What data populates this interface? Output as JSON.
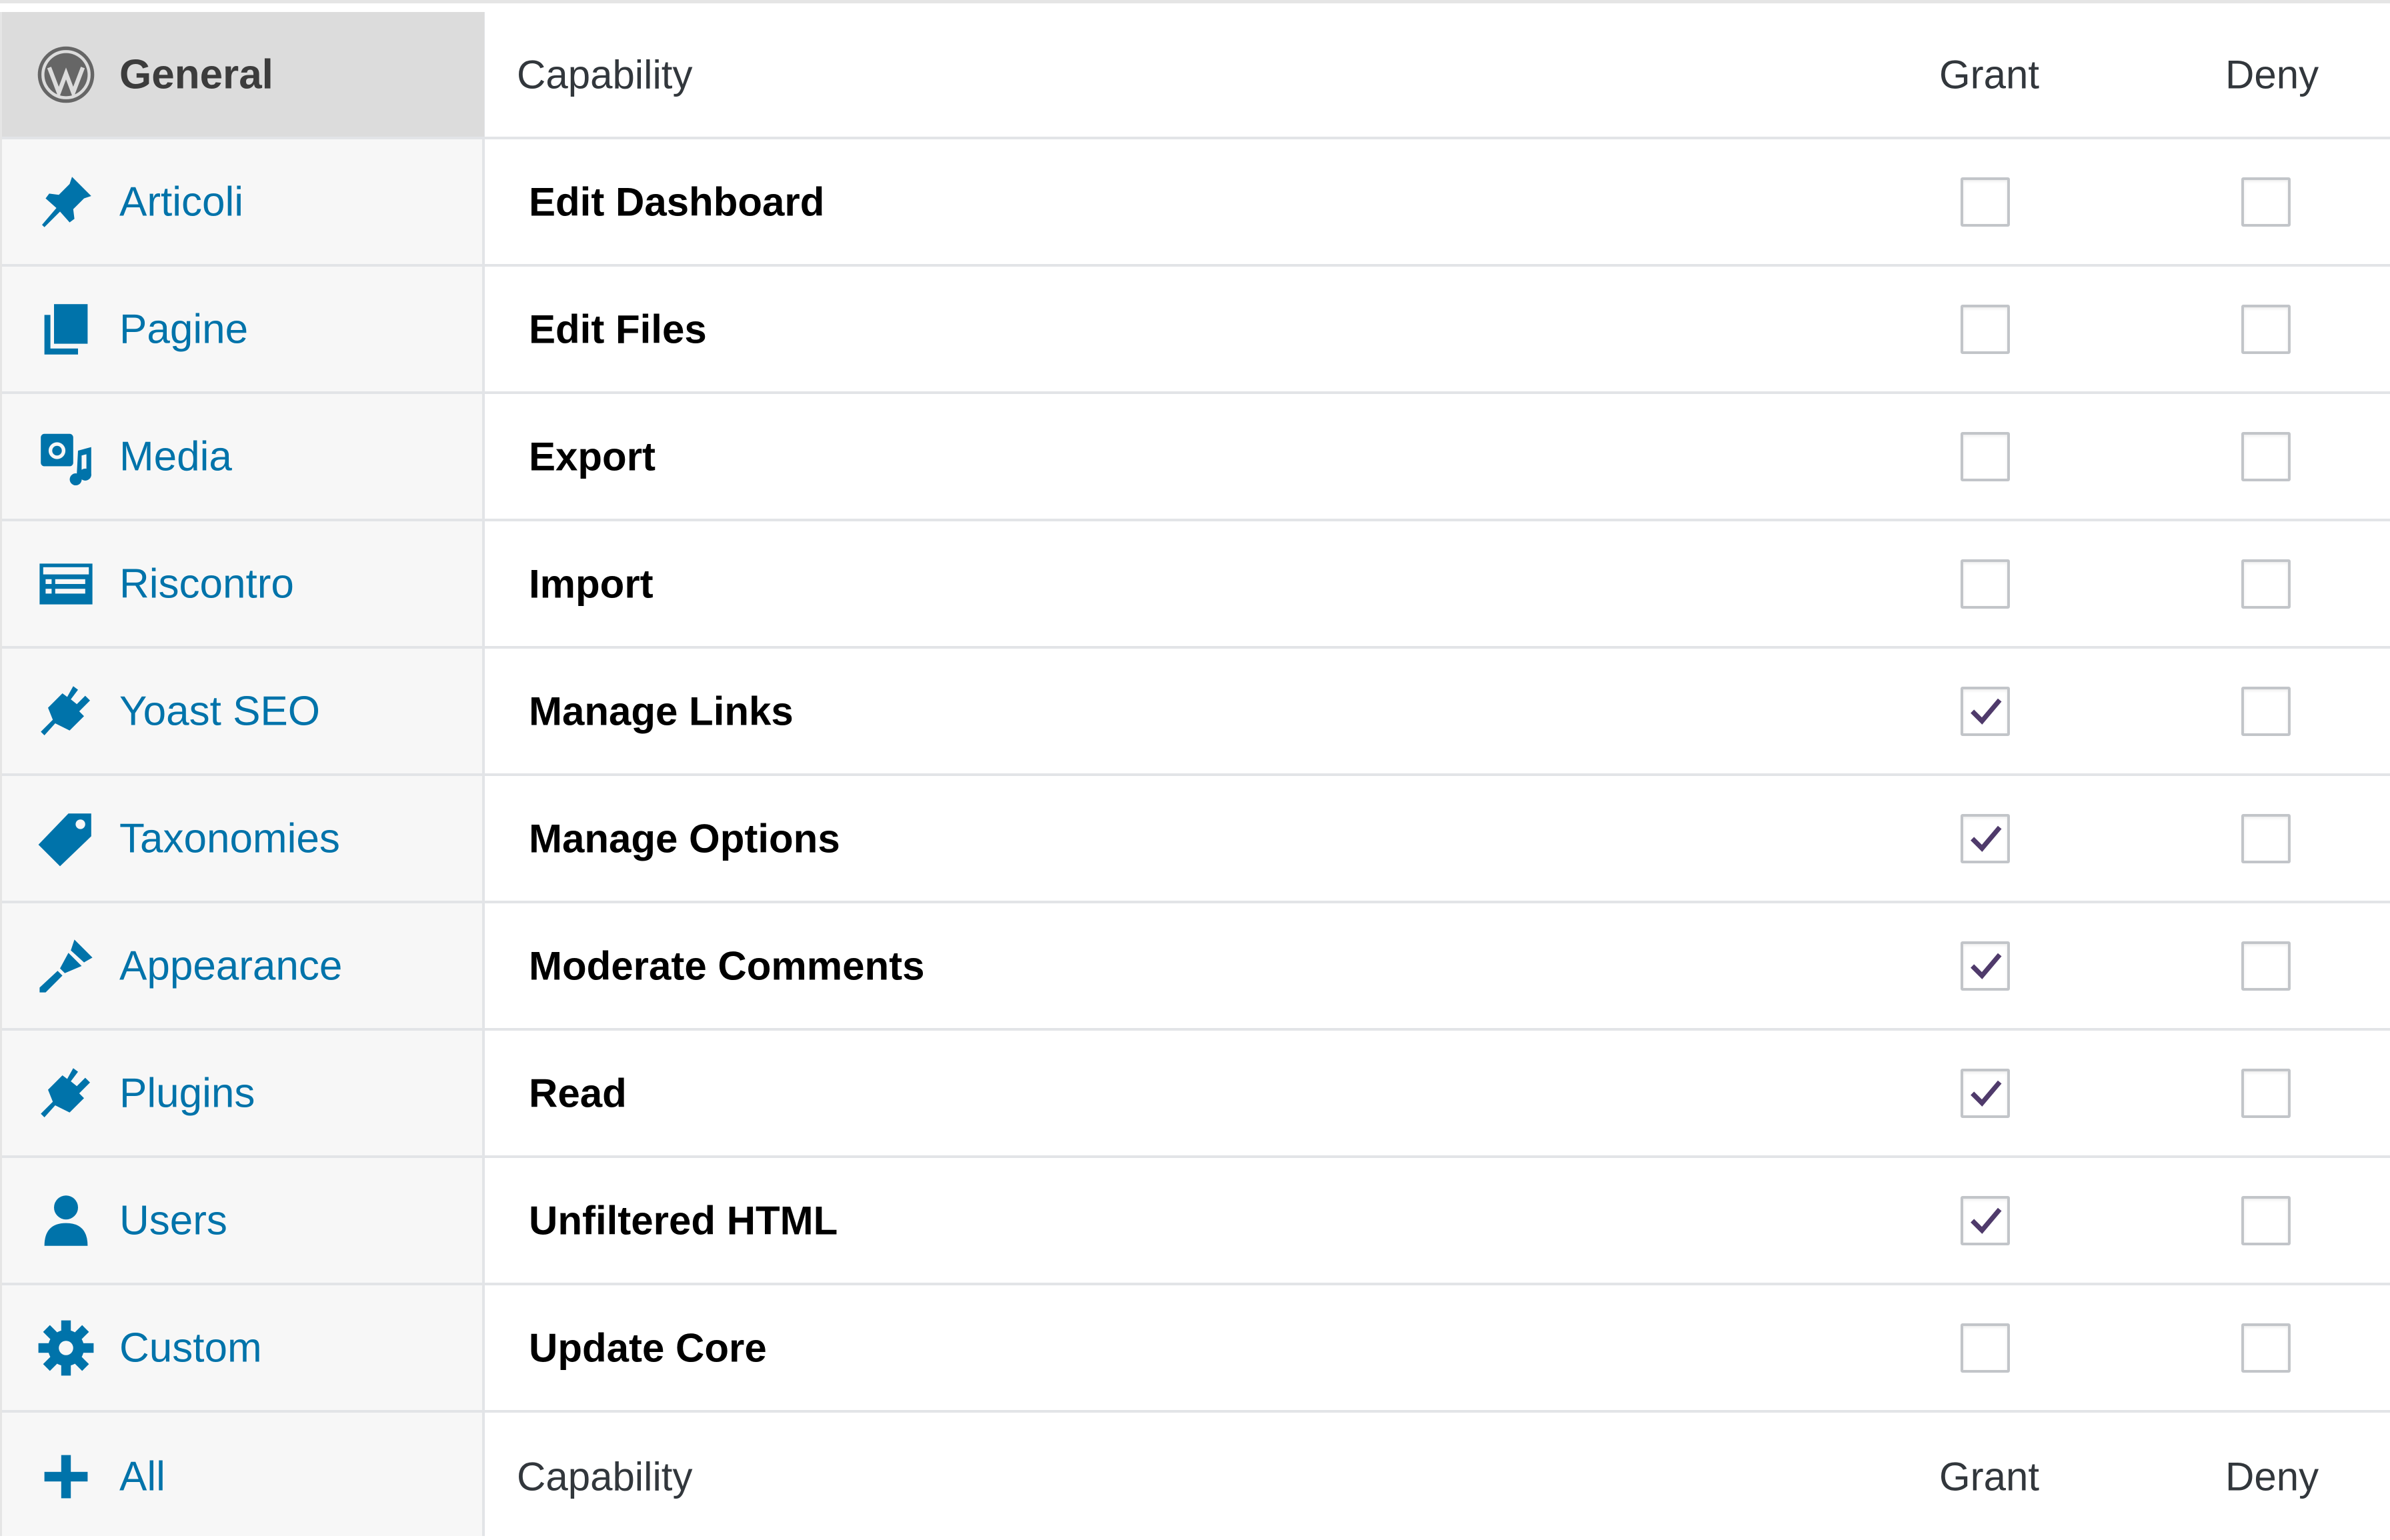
{
  "sidebar": {
    "items": [
      {
        "label": "General",
        "icon": "wordpress-logo-icon",
        "active": true
      },
      {
        "label": "Articoli",
        "icon": "pushpin-icon"
      },
      {
        "label": "Pagine",
        "icon": "pages-icon"
      },
      {
        "label": "Media",
        "icon": "media-icon"
      },
      {
        "label": "Riscontro",
        "icon": "feedback-icon"
      },
      {
        "label": "Yoast SEO",
        "icon": "plugin-icon"
      },
      {
        "label": "Taxonomies",
        "icon": "tag-icon"
      },
      {
        "label": "Appearance",
        "icon": "paintbrush-icon"
      },
      {
        "label": "Plugins",
        "icon": "plugin-icon"
      },
      {
        "label": "Users",
        "icon": "user-icon"
      },
      {
        "label": "Custom",
        "icon": "gear-icon"
      },
      {
        "label": "All",
        "icon": "plus-icon"
      }
    ]
  },
  "table": {
    "header": {
      "capability": "Capability",
      "grant": "Grant",
      "deny": "Deny"
    },
    "footer": {
      "capability": "Capability",
      "grant": "Grant",
      "deny": "Deny"
    },
    "rows": [
      {
        "capability": "Edit Dashboard",
        "grant": false,
        "deny": false
      },
      {
        "capability": "Edit Files",
        "grant": false,
        "deny": false
      },
      {
        "capability": "Export",
        "grant": false,
        "deny": false
      },
      {
        "capability": "Import",
        "grant": false,
        "deny": false
      },
      {
        "capability": "Manage Links",
        "grant": true,
        "deny": false
      },
      {
        "capability": "Manage Options",
        "grant": true,
        "deny": false
      },
      {
        "capability": "Moderate Comments",
        "grant": true,
        "deny": false
      },
      {
        "capability": "Read",
        "grant": true,
        "deny": false
      },
      {
        "capability": "Unfiltered HTML",
        "grant": true,
        "deny": false
      },
      {
        "capability": "Update Core",
        "grant": false,
        "deny": false
      }
    ]
  },
  "colors": {
    "link": "#0073aa",
    "check": "#4f3a6b",
    "active_bg": "#dcdcdc",
    "border": "#e2e4e7"
  }
}
